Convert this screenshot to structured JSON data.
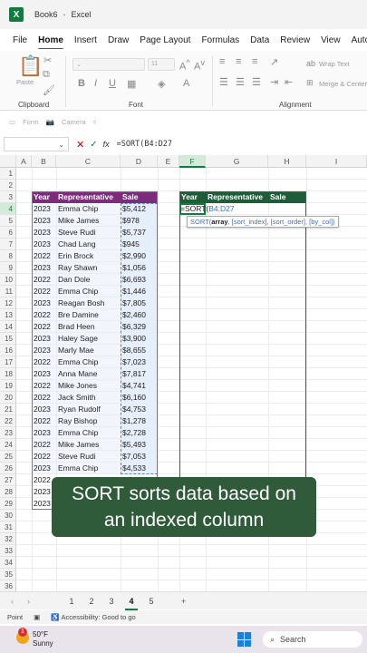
{
  "window": {
    "workbook": "Book6",
    "app": "Excel"
  },
  "ribbon_tabs": [
    "File",
    "Home",
    "Insert",
    "Draw",
    "Page Layout",
    "Formulas",
    "Data",
    "Review",
    "View",
    "Automate"
  ],
  "active_tab": "Home",
  "ribbon": {
    "clipboard_label": "Clipboard",
    "paste_label": "Paste",
    "font_label": "Font",
    "font_size": "11",
    "alignment_label": "Alignment",
    "wrap_text": "Wrap Text",
    "merge_center": "Merge & Center",
    "form_label": "Form",
    "camera_label": "Camera"
  },
  "formula_bar": {
    "name_box": "",
    "formula": "=SORT(B4:D27"
  },
  "columns": [
    "A",
    "B",
    "C",
    "D",
    "E",
    "F",
    "G",
    "H",
    "I"
  ],
  "rows": [
    "1",
    "2",
    "3",
    "4",
    "5",
    "6",
    "7",
    "8",
    "9",
    "10",
    "11",
    "12",
    "13",
    "14",
    "15",
    "16",
    "17",
    "18",
    "19",
    "20",
    "21",
    "22",
    "23",
    "24",
    "25",
    "26",
    "27",
    "28",
    "29",
    "30",
    "31",
    "32",
    "33",
    "34",
    "35",
    "36"
  ],
  "source_table": {
    "headers": [
      "Year",
      "Representative",
      "Sale"
    ],
    "rows": [
      [
        "2023",
        "Emma Chip",
        "$5,412"
      ],
      [
        "2023",
        "Mike James",
        "$978"
      ],
      [
        "2023",
        "Steve Rudi",
        "$5,737"
      ],
      [
        "2023",
        "Chad Lang",
        "$945"
      ],
      [
        "2022",
        "Erin Brock",
        "$2,990"
      ],
      [
        "2023",
        "Ray Shawn",
        "$1,056"
      ],
      [
        "2022",
        "Dan Dole",
        "$6,693"
      ],
      [
        "2022",
        "Emma Chip",
        "$1,446"
      ],
      [
        "2023",
        "Reagan Bosh",
        "$7,805"
      ],
      [
        "2022",
        "Bre Damine",
        "$2,460"
      ],
      [
        "2022",
        "Brad Heen",
        "$6,329"
      ],
      [
        "2023",
        "Haley Sage",
        "$3,900"
      ],
      [
        "2023",
        "Marly Mae",
        "$8,655"
      ],
      [
        "2022",
        "Emma Chip",
        "$7,023"
      ],
      [
        "2023",
        "Anna Mane",
        "$7,817"
      ],
      [
        "2022",
        "Mike Jones",
        "$4,741"
      ],
      [
        "2022",
        "Jack Smith",
        "$6,160"
      ],
      [
        "2023",
        "Ryan Rudolf",
        "$4,753"
      ],
      [
        "2022",
        "Ray Bishop",
        "$1,278"
      ],
      [
        "2023",
        "Emma Chip",
        "$2,728"
      ],
      [
        "2022",
        "Mike James",
        "$5,493"
      ],
      [
        "2022",
        "Steve Rudi",
        "$7,053"
      ],
      [
        "2023",
        "Emma Chip",
        "$4,533"
      ],
      [
        "2022",
        "",
        ""
      ],
      [
        "2023",
        "",
        ""
      ],
      [
        "2023",
        "",
        ""
      ]
    ]
  },
  "result_table": {
    "headers": [
      "Year",
      "Representative",
      "Sale"
    ],
    "editing_formula_prefix": "=SORT(",
    "editing_formula_ref": "B4:D27"
  },
  "tooltip": {
    "fn": "SORT(",
    "arg1": "array",
    "rest": ", [sort_index], [sort_order], [by_col])"
  },
  "caption": {
    "line1": "SORT sorts data based on",
    "line2": "an indexed column"
  },
  "sheet_tabs": [
    "1",
    "2",
    "3",
    "4",
    "5"
  ],
  "active_sheet": "4",
  "status": {
    "mode": "Point",
    "accessibility": "Accessibility: Good to go"
  },
  "taskbar": {
    "temp": "50°F",
    "condition": "Sunny",
    "badge": "1",
    "search": "Search"
  },
  "colors": {
    "excel_green": "#107c41",
    "purple_header": "#7b2c7a",
    "green_header": "#1f5c3a",
    "caption_bg": "#2f5b3a"
  }
}
